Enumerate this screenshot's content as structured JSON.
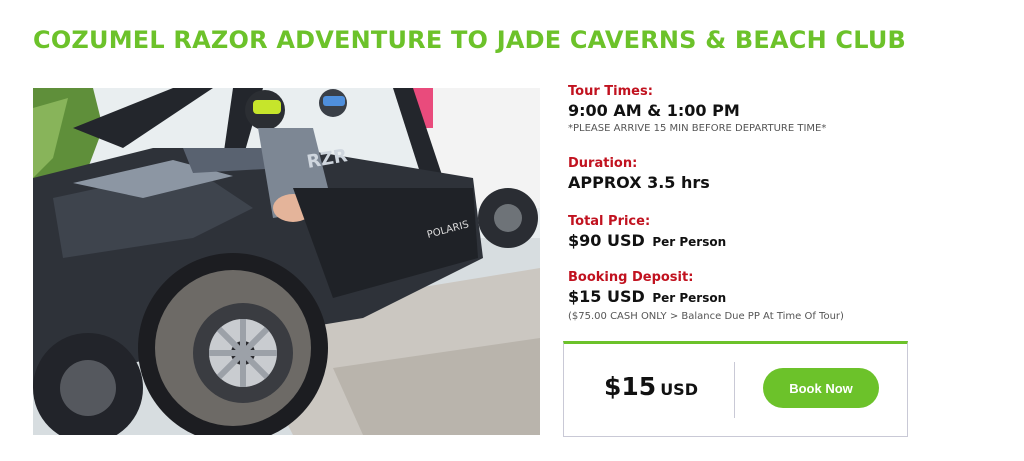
{
  "page": {
    "title": "COZUMEL RAZOR ADVENTURE TO JADE CAVERNS & BEACH CLUB"
  },
  "tour": {
    "times_label": "Tour Times:",
    "times_value": "9:00 AM & 1:00 PM",
    "times_note": "*PLEASE ARRIVE 15 MIN BEFORE DEPARTURE TIME*",
    "duration_label": "Duration:",
    "duration_value": "APPROX 3.5 hrs",
    "price_label": "Total Price:",
    "price_value": "$90 USD",
    "price_suffix": "Per Person",
    "deposit_label": "Booking Deposit:",
    "deposit_value": "$15 USD",
    "deposit_suffix": "Per Person",
    "deposit_note": "($75.00 CASH ONLY > Balance Due PP At Time Of Tour)"
  },
  "booking": {
    "amount": "$15",
    "currency": "USD",
    "button_label": "Book Now"
  },
  "colors": {
    "accent": "#6cc22a",
    "label_red": "#c1121f"
  },
  "image": {
    "subject": "polaris-razor-utv-photo"
  }
}
